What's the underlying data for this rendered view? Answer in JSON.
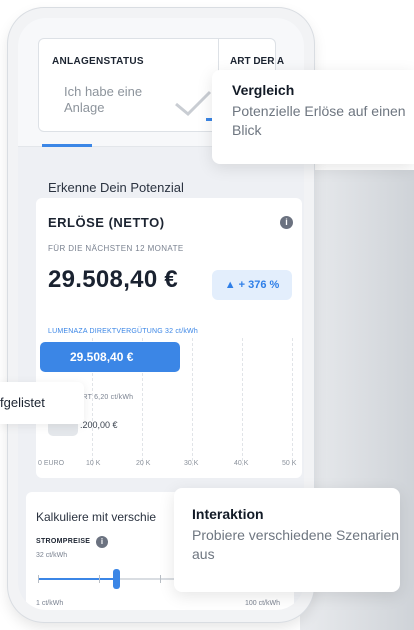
{
  "status": {
    "title": "ANLAGENSTATUS",
    "subtitle": "Ich habe eine Anlage",
    "next_title": "ART DER A"
  },
  "section": {
    "heading": "Erkenne Dein Potenzial"
  },
  "results": {
    "title": "ERLÖSE (NETTO)",
    "subtitle": "FÜR DIE NÄCHSTEN 12 MONATE",
    "amount": "29.508,40 €",
    "badge": "▲ + 376 %",
    "legend_a": "LUMENAZA DIREKTVERGÜTUNG 32 ct/kWh",
    "bar_a_value": "29.508,40 €",
    "legend_b": "NDER WERT 6,20 ct/kWh",
    "bar_b_value": ".200,00 €",
    "x_ticks": [
      "0 EURO",
      "10 K",
      "20 K",
      "30 K",
      "40 K",
      "50 K"
    ]
  },
  "calc": {
    "title": "Kalkuliere mit verschie",
    "strom_label": "STROMPREISE",
    "strom_value": "32 ct/kWh",
    "min_label": "1 ct/kWh",
    "max_label": "100 ct/kWh",
    "slider_value_fraction": 0.32
  },
  "tooltip_left": {
    "text": "fgelistet"
  },
  "callouts": [
    {
      "title": "Vergleich",
      "body": "Potenzielle Erlöse auf einen Blick"
    },
    {
      "title": "Interaktion",
      "body": "Probiere verschiedene Szenarien aus"
    }
  ],
  "colors": {
    "accent": "#3b86e6",
    "accent_light": "#e3eefc",
    "text": "#1c2431",
    "muted": "#7a8290"
  }
}
